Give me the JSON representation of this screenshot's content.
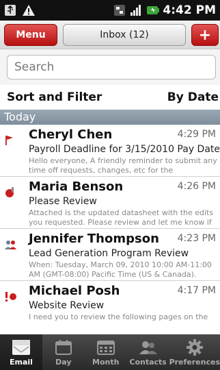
{
  "status_bar": {
    "time": "4:42 PM",
    "icons": [
      "usb-icon",
      "warning-icon",
      "sync-icon",
      "signal-icon",
      "battery-icon"
    ]
  },
  "top_bar": {
    "menu_label": "Menu",
    "inbox_label": "Inbox (12)",
    "add_label": "+"
  },
  "search": {
    "placeholder": "Search"
  },
  "sort": {
    "label": "Sort and Filter",
    "value": "By Date"
  },
  "section": {
    "title": "Today"
  },
  "messages": [
    {
      "sender": "Cheryl Chen",
      "time": "4:29 PM",
      "subject": "Payroll Deadline for 3/15/2010 Pay Date",
      "preview": "Hello everyone, A friendly reminder to submit any time off requests, changes, etc for the 03/01/201...",
      "icon": "flag-icon"
    },
    {
      "sender": "Maria Benson",
      "time": "4:26 PM",
      "subject": "Please Review",
      "preview": "Attached is the updated datasheet with the edits you requested. Please review and let me know if ...",
      "icon": "attachment-icon"
    },
    {
      "sender": "Jennifer Thompson",
      "time": "4:23 PM",
      "subject": "Lead Generation Program Review",
      "preview": "When: Tuesday, March 09, 2010 10:00 AM-11:00 AM (GMT-08:00) Pacific Time (US & Canada). Whe...",
      "icon": "meeting-icon"
    },
    {
      "sender": "Michael Posh",
      "time": "4:17 PM",
      "subject": "Website Review",
      "preview": "I need you to review the following pages on the",
      "icon": "urgent-icon"
    }
  ],
  "tabs": [
    {
      "label": "Email",
      "icon": "good-email-icon",
      "active": true
    },
    {
      "label": "Day",
      "icon": "calendar-day-icon",
      "active": false
    },
    {
      "label": "Month",
      "icon": "calendar-month-icon",
      "active": false
    },
    {
      "label": "Contacts",
      "icon": "contacts-icon",
      "active": false
    },
    {
      "label": "Preferences",
      "icon": "gear-icon",
      "active": false
    }
  ],
  "colors": {
    "accent_red": "#c81e1e",
    "section_header": "#8a98a6",
    "tab_bar": "#333333"
  }
}
